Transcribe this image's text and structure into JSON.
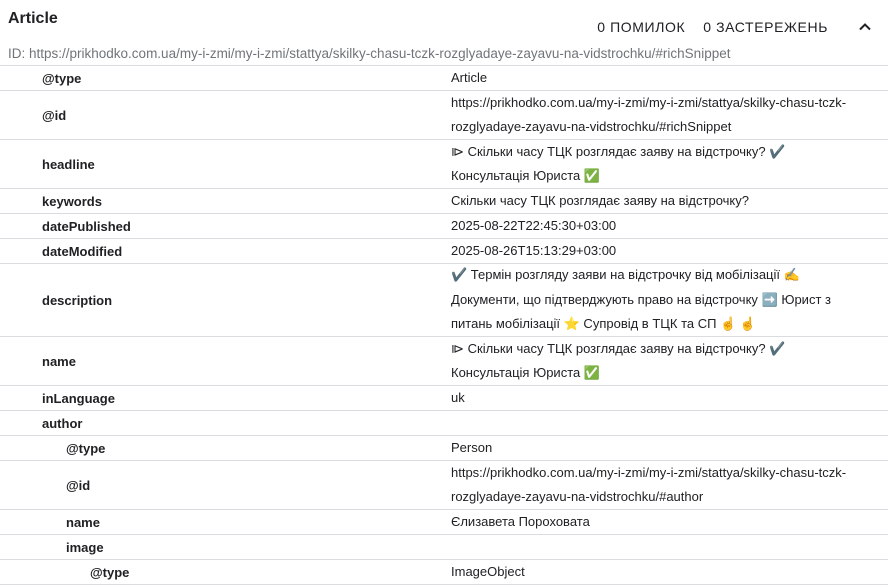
{
  "header": {
    "title": "Article",
    "errors": "0 ПОМИЛОК",
    "warnings": "0 ЗАСТЕРЕЖЕНЬ",
    "id_line": "ID: https://prikhodko.com.ua/my-i-zmi/my-i-zmi/stattya/skilky-chasu-tczk-rozglyadaye-zayavu-na-vidstrochku/#richSnippet",
    "collapse_icon": "chevron-up-icon"
  },
  "rows": [
    {
      "key": "@type",
      "value": "Article"
    },
    {
      "key": "@id",
      "value": "https://prikhodko.com.ua/my-i-zmi/my-i-zmi/stattya/skilky-chasu-tczk-rozglyadaye-zayavu-na-vidstrochku/#richSnippet"
    },
    {
      "key": "headline",
      "value": "⧐ Скільки часу ТЦК розглядає заяву на відстрочку? ✔️ Консультація Юриста ✅"
    },
    {
      "key": "keywords",
      "value": "Скільки часу ТЦК розглядає заяву на відстрочку?"
    },
    {
      "key": "datePublished",
      "value": "2025-08-22T22:45:30+03:00"
    },
    {
      "key": "dateModified",
      "value": "2025-08-26T15:13:29+03:00"
    },
    {
      "key": "description",
      "value": "✔️ Термін розгляду заяви на відстрочку від мобілізації ✍️ Документи, що підтверджують право на відстрочку ➡️ Юрист з питань мобілізації ⭐ Супровід в ТЦК та СП ☝️ ☝️"
    },
    {
      "key": "name",
      "value": "⧐ Скільки часу ТЦК розглядає заяву на відстрочку? ✔️ Консультація Юриста ✅"
    },
    {
      "key": "inLanguage",
      "value": "uk"
    },
    {
      "key": "author",
      "value": ""
    },
    {
      "key": "@type",
      "value": "Person"
    },
    {
      "key": "@id",
      "value": "https://prikhodko.com.ua/my-i-zmi/my-i-zmi/stattya/skilky-chasu-tczk-rozglyadaye-zayavu-na-vidstrochku/#author"
    },
    {
      "key": "name",
      "value": "Єлизавета Пороховата"
    },
    {
      "key": "image",
      "value": ""
    },
    {
      "key": "@type",
      "value": "ImageObject"
    }
  ]
}
